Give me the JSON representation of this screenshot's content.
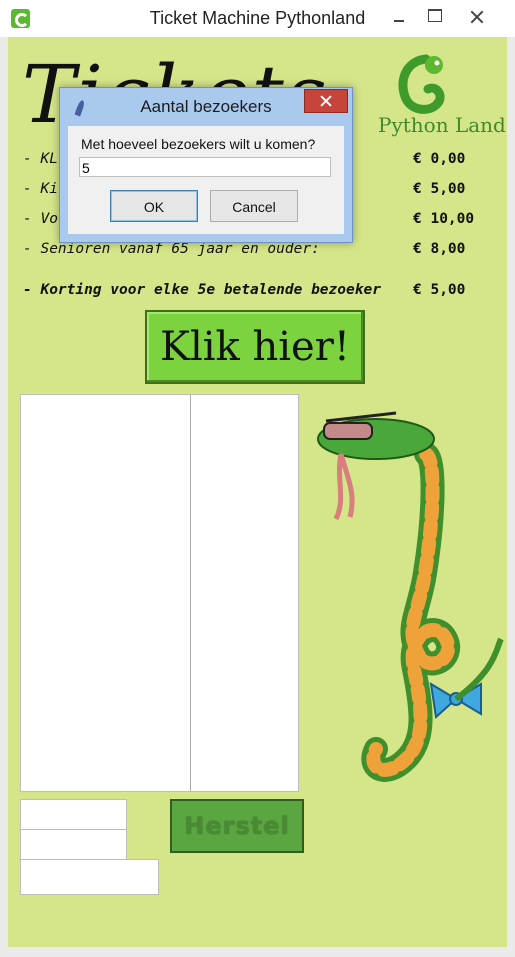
{
  "window": {
    "title": "Ticket Machine Pythonland",
    "icon": "python-land-icon",
    "controls": [
      "minimize",
      "maximize",
      "close"
    ]
  },
  "header": {
    "title": "Tickets",
    "logo_text": "Python Land"
  },
  "prices": [
    {
      "label": "- KL",
      "value": "€ 0,00"
    },
    {
      "label": "- Ki",
      "value": "€ 5,00"
    },
    {
      "label": "- Vo",
      "value": "€ 10,00"
    },
    {
      "label": "- Senioren vanaf 65 jaar en ouder:",
      "value": "€ 8,00"
    }
  ],
  "discount": {
    "label": "- Korting voor elke 5e betalende bezoeker",
    "value": "€ 5,00"
  },
  "buttons": {
    "click_label": "Klik hier!",
    "reset_label": "Herstel"
  },
  "dialog": {
    "title": "Aantal bezoekers",
    "prompt": "Met hoeveel bezoekers wilt u komen?",
    "input_value": "5",
    "ok_label": "OK",
    "cancel_label": "Cancel"
  },
  "colors": {
    "background": "#d5e589",
    "button_green": "#7cd23f",
    "reset_green": "#5aa641"
  }
}
